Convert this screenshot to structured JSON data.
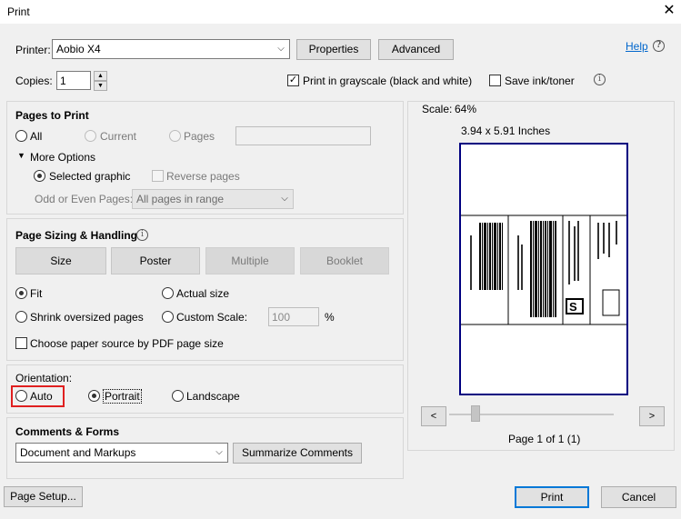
{
  "window": {
    "title": "Print",
    "close_symbol": "✕"
  },
  "printer": {
    "label": "Printer:",
    "selected": "Aobio X4",
    "properties_label": "Properties",
    "advanced_label": "Advanced",
    "help_label": "Help"
  },
  "copies": {
    "label": "Copies:",
    "value": "1"
  },
  "options": {
    "grayscale_label": "Print in grayscale (black and white)",
    "grayscale_checked": true,
    "save_ink_label": "Save ink/toner",
    "save_ink_checked": false
  },
  "pages_to_print": {
    "title": "Pages to Print",
    "all_label": "All",
    "current_label": "Current",
    "pages_label": "Pages",
    "pages_value": "",
    "more_options_label": "More Options",
    "selected_graphic_label": "Selected graphic",
    "reverse_pages_label": "Reverse pages",
    "odd_even_label": "Odd or Even Pages:",
    "odd_even_value": "All pages in range"
  },
  "sizing": {
    "title": "Page Sizing & Handling",
    "size_label": "Size",
    "poster_label": "Poster",
    "multiple_label": "Multiple",
    "booklet_label": "Booklet",
    "fit_label": "Fit",
    "actual_size_label": "Actual size",
    "shrink_label": "Shrink oversized pages",
    "custom_scale_label": "Custom Scale:",
    "custom_scale_value": "100",
    "percent_label": "%",
    "paper_source_label": "Choose paper source by PDF page size"
  },
  "orientation": {
    "title": "Orientation:",
    "auto_label": "Auto",
    "portrait_label": "Portrait",
    "landscape_label": "Landscape",
    "selected": "portrait"
  },
  "comments_forms": {
    "title": "Comments & Forms",
    "selected": "Document and Markups",
    "summarize_label": "Summarize Comments"
  },
  "preview": {
    "scale_label": "Scale:",
    "scale_value": "64%",
    "dimensions": "3.94 x 5.91 Inches",
    "prev_symbol": "<",
    "next_symbol": ">",
    "page_indicator": "Page 1 of 1 (1)"
  },
  "footer": {
    "page_setup_label": "Page Setup...",
    "print_label": "Print",
    "cancel_label": "Cancel"
  },
  "colors": {
    "accent": "#0078d7",
    "highlight": "#e02020",
    "preview_border": "#000080"
  }
}
